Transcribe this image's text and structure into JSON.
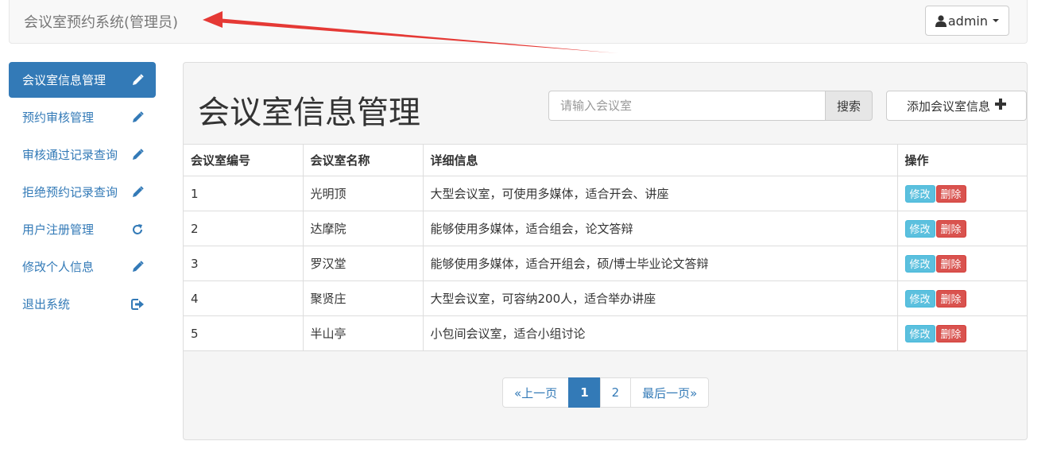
{
  "navbar": {
    "brand": "会议室预约系统(管理员)",
    "user_label": "admin",
    "user_icon": "user-icon",
    "annotation_color": "#e53935"
  },
  "sidebar": {
    "items": [
      {
        "label": "会议室信息管理",
        "icon": "pencil-icon",
        "active": true
      },
      {
        "label": "预约审核管理",
        "icon": "pencil-icon",
        "active": false
      },
      {
        "label": "审核通过记录查询",
        "icon": "pencil-icon",
        "active": false
      },
      {
        "label": "拒绝预约记录查询",
        "icon": "pencil-icon",
        "active": false
      },
      {
        "label": "用户注册管理",
        "icon": "refresh-icon",
        "active": false
      },
      {
        "label": "修改个人信息",
        "icon": "pencil-icon",
        "active": false
      },
      {
        "label": "退出系统",
        "icon": "logout-icon",
        "active": false
      }
    ]
  },
  "main": {
    "title": "会议室信息管理",
    "search": {
      "placeholder": "请输入会议室",
      "button": "搜索"
    },
    "add_button": "添加会议室信息",
    "table": {
      "headers": [
        "会议室编号",
        "会议室名称",
        "详细信息",
        "操作"
      ],
      "rows": [
        {
          "id": "1",
          "name": "光明顶",
          "detail": "大型会议室，可使用多媒体，适合开会、讲座",
          "edit": "修改",
          "delete": "删除"
        },
        {
          "id": "2",
          "name": "达摩院",
          "detail": "能够使用多媒体，适合组会，论文答辩",
          "edit": "修改",
          "delete": "删除"
        },
        {
          "id": "3",
          "name": "罗汉堂",
          "detail": "能够使用多媒体，适合开组会，硕/博士毕业论文答辩",
          "edit": "修改",
          "delete": "删除"
        },
        {
          "id": "4",
          "name": "聚贤庄",
          "detail": "大型会议室，可容纳200人，适合举办讲座",
          "edit": "修改",
          "delete": "删除"
        },
        {
          "id": "5",
          "name": "半山亭",
          "detail": "小包间会议室，适合小组讨论",
          "edit": "修改",
          "delete": "删除"
        }
      ]
    },
    "pagination": {
      "prev": "«上一页",
      "pages": [
        "1",
        "2"
      ],
      "current": "1",
      "last": "最后一页»"
    }
  },
  "colors": {
    "primary": "#337ab7",
    "info": "#5bc0de",
    "danger": "#d9534f"
  }
}
